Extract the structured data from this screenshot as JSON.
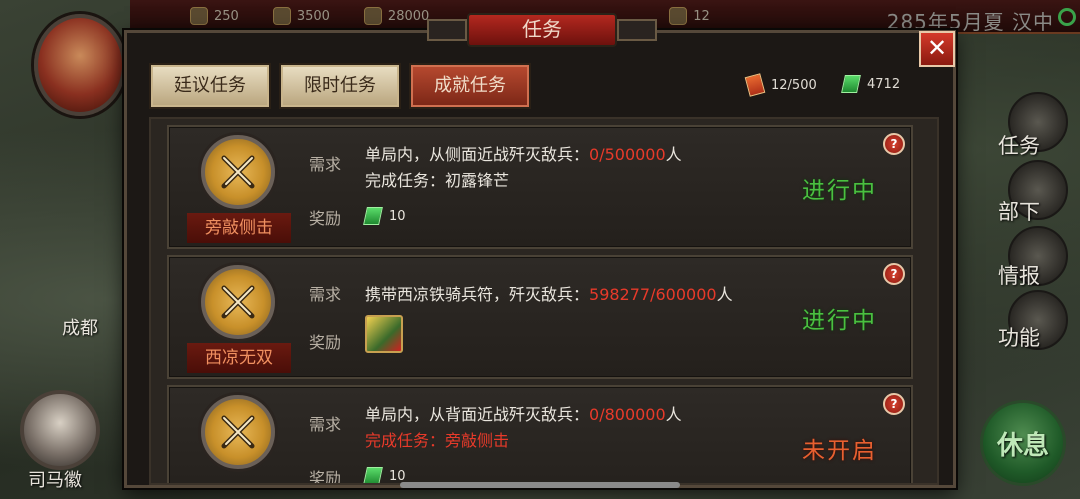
{
  "topbar": {
    "resources": [
      "250",
      "3500",
      "28000",
      "12"
    ],
    "date": "285年5月夏 汉中"
  },
  "map": {
    "city_label": "成都",
    "general_name": "司马徽"
  },
  "side_menu": [
    "任务",
    "部下",
    "情报",
    "功能"
  ],
  "rest_button": "休息",
  "dialog": {
    "title": "任务",
    "close": "✕",
    "tabs": [
      "廷议任务",
      "限时任务",
      "成就任务"
    ],
    "active_tab": 2,
    "tokens": "12/500",
    "jade": "4712"
  },
  "labels": {
    "req": "需求",
    "reward": "奖励",
    "help": "?"
  },
  "tasks": [
    {
      "name": "旁敲侧击",
      "req_text": "单局内，从侧面近战歼灭敌兵：",
      "progress": "0/500000",
      "unit": "人",
      "prereq": "完成任务：初露锋芒",
      "reward_amount": "10",
      "status": "进行中"
    },
    {
      "name": "西凉无双",
      "req_text": "携带西凉铁骑兵符，歼灭敌兵：",
      "progress": "598277/600000",
      "unit": "人",
      "status": "进行中"
    },
    {
      "name": "",
      "req_text": "单局内，从背面近战歼灭敌兵：",
      "progress": "0/800000",
      "unit": "人",
      "prereq": "完成任务：旁敲侧击",
      "reward_amount": "10",
      "status": "未开启"
    }
  ]
}
